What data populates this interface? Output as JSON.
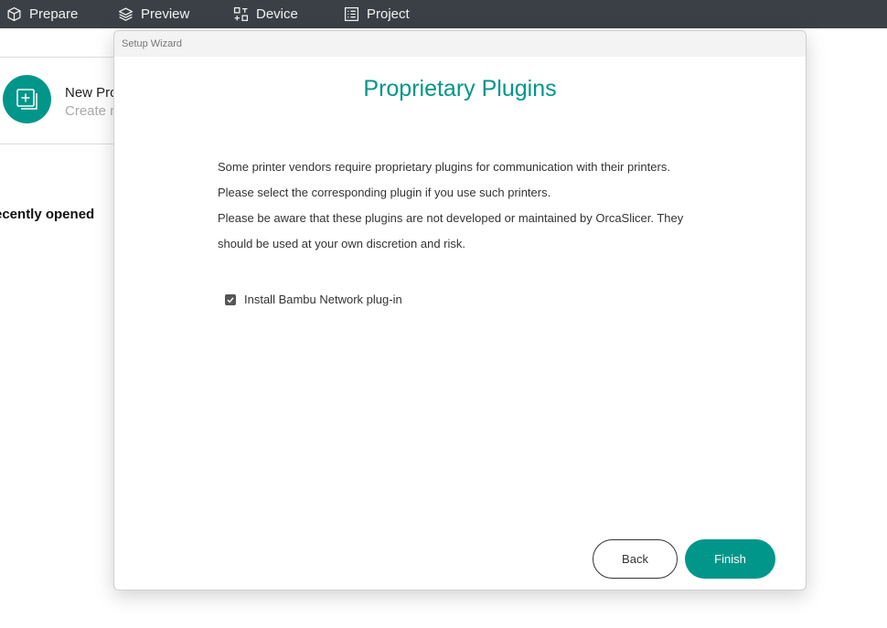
{
  "topbar": {
    "tabs": [
      {
        "label": "Prepare",
        "icon": "cube-icon"
      },
      {
        "label": "Preview",
        "icon": "layers-icon"
      },
      {
        "label": "Device",
        "icon": "device-icon"
      },
      {
        "label": "Project",
        "icon": "list-icon"
      }
    ]
  },
  "home": {
    "new_project_title": "New Pro",
    "new_project_subtitle": "Create n",
    "recent_label": "ecently opened"
  },
  "dialog": {
    "window_title": "Setup Wizard",
    "heading": "Proprietary Plugins",
    "paragraph_lines": [
      "Some printer vendors require proprietary plugins for communication with their printers.",
      "Please select the corresponding plugin if you use such printers.",
      "Please be aware that these plugins are not developed or maintained by OrcaSlicer. They",
      "should be used at your own discretion and risk."
    ],
    "checkbox": {
      "label": "Install Bambu Network plug-in",
      "checked": true
    },
    "back_label": "Back",
    "finish_label": "Finish",
    "accent_color": "#00968a"
  }
}
